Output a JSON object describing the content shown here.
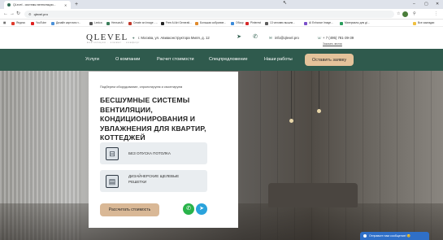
{
  "browser": {
    "tab_title": "QLevel - системы вентиляции...",
    "url": "qlevel.pro",
    "bookmarks": [
      "Яндекс",
      "YouTube",
      "Дизайн карточек т...",
      "Lexica",
      "HensonAI",
      "Create an Image - ...",
      "Free AI Art Generati...",
      "Большая собрание...",
      "Обзор",
      "Pinterest",
      "13 человек вышли...",
      "AI Enhance Image...",
      "Материалы для дi..."
    ],
    "other_bookmarks": "Все закладки"
  },
  "header": {
    "logo": "QLEVEL",
    "logo_sub": "вентиляция · климат · комфорт",
    "address": "г. Москва, ул. Авиаконструктора Миля, д. 12",
    "email": "info@qlevel.pro",
    "phone": "+ 7 (495) 781-39-39",
    "callback": "Заказать звонок"
  },
  "nav": {
    "items": [
      "Услуги",
      "О компании",
      "Расчет стоимости",
      "Спецпредложение",
      "Наши работы"
    ],
    "cta": "Оставить заявку"
  },
  "hero": {
    "subtitle": "Подберем оборудование, спроектируем и смонтируем",
    "title": "БЕСШУМНЫЕ СИСТЕМЫ ВЕНТИЛЯЦИИ, КОНДИЦИОНИРОВАНИЯ И УВЛАЖНЕНИЯ ДЛЯ КВАРТИР, КОТТЕДЖЕЙ",
    "features": [
      "БЕЗ ОПУСКА ПОТОЛКА",
      "ДИЗАЙНЕРСКИЕ ЩЕЛЕВЫЕ РЕШЕТКИ"
    ],
    "button": "Рассчитать стоимость"
  },
  "chat": {
    "label": "Отправьте нам сообщение! 😊"
  }
}
